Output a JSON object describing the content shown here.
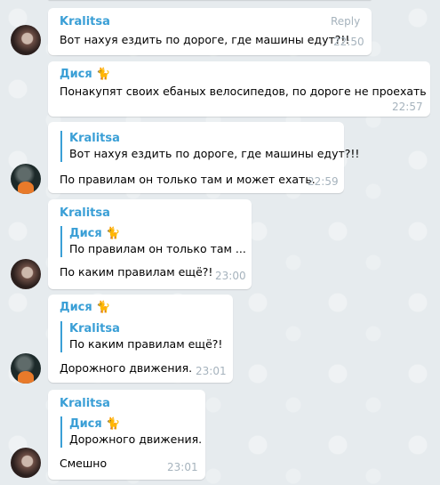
{
  "messages": [
    {
      "sender": "Kralitsa",
      "text": "Вот нахуя ездить по дороге, где машины едут?!!",
      "time": "22:50",
      "reply_label": "Reply"
    },
    {
      "sender": "Дися",
      "sender_emoji": "🐈",
      "text": "Понакупят своих ебаных велосипедов, по дороге не проехать",
      "time": "22:57"
    },
    {
      "quote_sender": "Kralitsa",
      "quote_text": "Вот нахуя ездить по дороге, где машины едут?!!",
      "text": "По правилам он только там и может ехать.",
      "time": "22:59"
    },
    {
      "sender": "Kralitsa",
      "quote_sender": "Дися",
      "quote_sender_emoji": "🐈",
      "quote_text": "По правилам он только там ...",
      "text": "По каким правилам ещё?!",
      "time": "23:00"
    },
    {
      "sender": "Дися",
      "sender_emoji": "🐈",
      "quote_sender": "Kralitsa",
      "quote_text": "По каким правилам ещё?!",
      "text": "Дорожного движения.",
      "time": "23:01"
    },
    {
      "sender": "Kralitsa",
      "quote_sender": "Дися",
      "quote_sender_emoji": "🐈",
      "quote_text": "Дорожного движения.",
      "text": "Смешно",
      "time": "23:01"
    }
  ]
}
